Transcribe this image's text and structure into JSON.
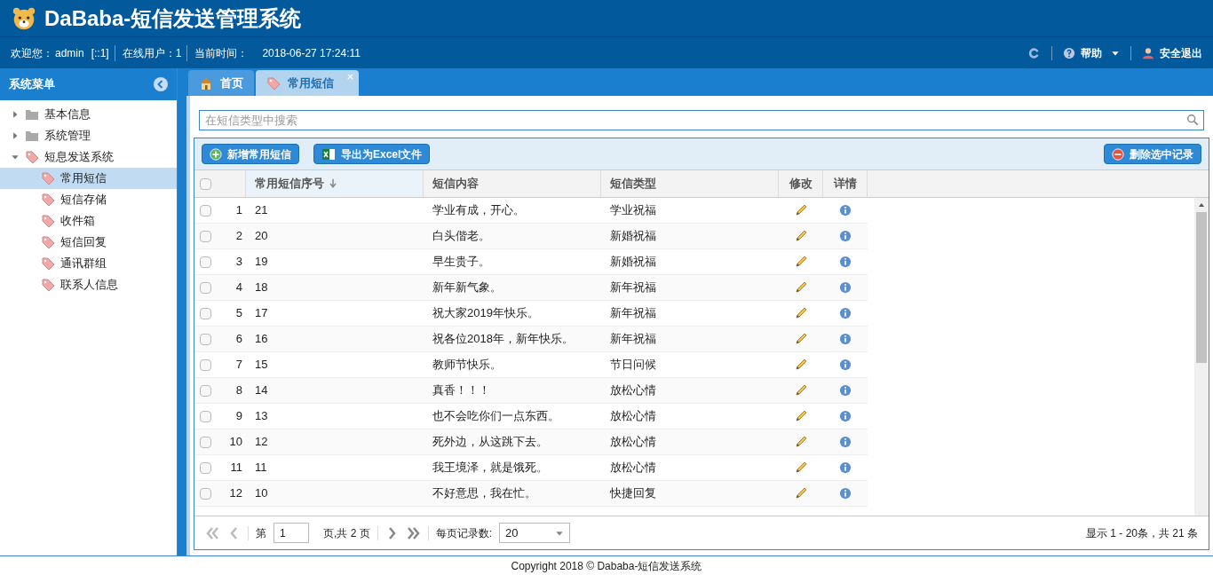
{
  "header": {
    "title": "DaBaba-短信发送管理系统"
  },
  "userbar": {
    "welcome_label": "欢迎您：",
    "user": "admin",
    "ip": "[::1]",
    "online_label": "在线用户：",
    "online": "1",
    "time_label": "当前时间：",
    "time": "2018-06-27 17:24:11",
    "help": "帮助",
    "logout": "安全退出"
  },
  "sidebar": {
    "title": "系统菜单",
    "items": [
      {
        "label": "基本信息",
        "kind": "folder",
        "expanded": false,
        "selected": false
      },
      {
        "label": "系统管理",
        "kind": "folder",
        "expanded": false,
        "selected": false
      },
      {
        "label": "短息发送系统",
        "kind": "tag",
        "expanded": true,
        "selected": false,
        "children": [
          {
            "label": "常用短信",
            "selected": true
          },
          {
            "label": "短信存储",
            "selected": false
          },
          {
            "label": "收件箱",
            "selected": false
          },
          {
            "label": "短信回复",
            "selected": false
          },
          {
            "label": "通讯群组",
            "selected": false
          },
          {
            "label": "联系人信息",
            "selected": false
          }
        ]
      }
    ]
  },
  "tabs": [
    {
      "label": "首页",
      "kind": "home",
      "selected": false,
      "closable": false
    },
    {
      "label": "常用短信",
      "kind": "tag",
      "selected": true,
      "closable": true
    }
  ],
  "search": {
    "placeholder": "在短信类型中搜索"
  },
  "toolbar": [
    {
      "label": "新增常用短信",
      "kind": "add"
    },
    {
      "label": "导出为Excel文件",
      "kind": "excel"
    },
    {
      "label": "删除选中记录",
      "kind": "delete"
    }
  ],
  "table": {
    "all_checked": false,
    "columns": [
      "常用短信序号",
      "短信内容",
      "短信类型",
      "修改",
      "详情"
    ],
    "rows": [
      {
        "index": "1",
        "id": "21",
        "content": "学业有成，开心。",
        "type": "学业祝福",
        "checked": false
      },
      {
        "index": "2",
        "id": "20",
        "content": "白头偕老。",
        "type": "新婚祝福",
        "checked": false
      },
      {
        "index": "3",
        "id": "19",
        "content": "早生贵子。",
        "type": "新婚祝福",
        "checked": false
      },
      {
        "index": "4",
        "id": "18",
        "content": "新年新气象。",
        "type": "新年祝福",
        "checked": false
      },
      {
        "index": "5",
        "id": "17",
        "content": "祝大家2019年快乐。",
        "type": "新年祝福",
        "checked": false
      },
      {
        "index": "6",
        "id": "16",
        "content": "祝各位2018年，新年快乐。",
        "type": "新年祝福",
        "checked": false
      },
      {
        "index": "7",
        "id": "15",
        "content": "教师节快乐。",
        "type": "节日问候",
        "checked": false
      },
      {
        "index": "8",
        "id": "14",
        "content": "真香！！！",
        "type": "放松心情",
        "checked": false
      },
      {
        "index": "9",
        "id": "13",
        "content": "也不会吃你们一点东西。",
        "type": "放松心情",
        "checked": false
      },
      {
        "index": "10",
        "id": "12",
        "content": "死外边，从这跳下去。",
        "type": "放松心情",
        "checked": false
      },
      {
        "index": "11",
        "id": "11",
        "content": "我王境泽，就是饿死。",
        "type": "放松心情",
        "checked": false
      },
      {
        "index": "12",
        "id": "10",
        "content": "不好意思，我在忙。",
        "type": "快捷回复",
        "checked": false
      }
    ]
  },
  "pager": {
    "page_label": "第",
    "page": "1",
    "pages_label": "页,共 2 页",
    "per_page_label": "每页记录数:",
    "per_page": "20",
    "summary": "显示 1 - 20条，共 21 条"
  },
  "footer": "Copyright 2018 © Dababa-短信发送系统"
}
